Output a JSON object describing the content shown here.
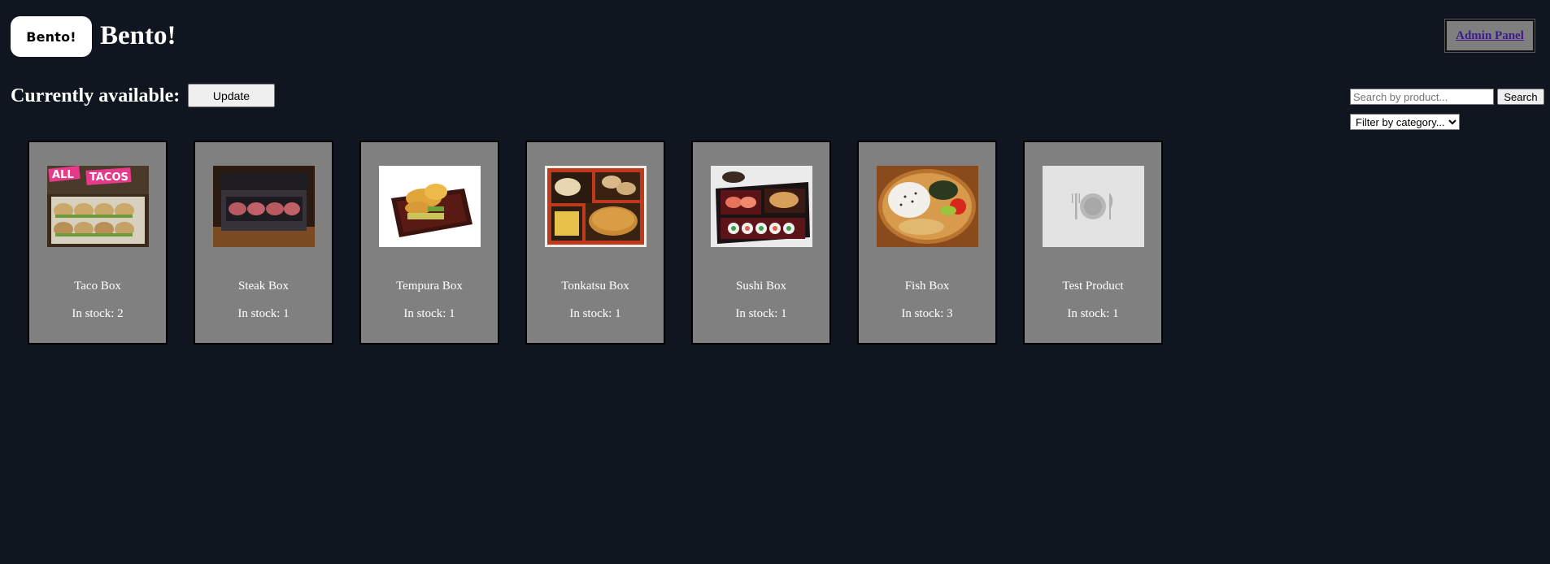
{
  "header": {
    "logo_text": "Bento!",
    "site_title": "Bento!",
    "admin_link": "Admin Panel"
  },
  "toolbar": {
    "section_title": "Currently available:",
    "update_label": "Update",
    "search_placeholder": "Search by product...",
    "search_label": "Search",
    "category_selected": "Filter by category..."
  },
  "products": [
    {
      "name": "Taco Box",
      "stock": "In stock: 2",
      "image": "taco-box-image"
    },
    {
      "name": "Steak Box",
      "stock": "In stock: 1",
      "image": "steak-box-image"
    },
    {
      "name": "Tempura Box",
      "stock": "In stock: 1",
      "image": "tempura-box-image"
    },
    {
      "name": "Tonkatsu Box",
      "stock": "In stock: 1",
      "image": "tonkatsu-box-image"
    },
    {
      "name": "Sushi Box",
      "stock": "In stock: 1",
      "image": "sushi-box-image"
    },
    {
      "name": "Fish Box",
      "stock": "In stock: 3",
      "image": "fish-box-image"
    },
    {
      "name": "Test Product",
      "stock": "In stock: 1",
      "image": "placeholder-plate-icon"
    }
  ],
  "colors": {
    "background": "#0f1620",
    "card": "#808080",
    "admin_link": "#3d1a8a"
  }
}
